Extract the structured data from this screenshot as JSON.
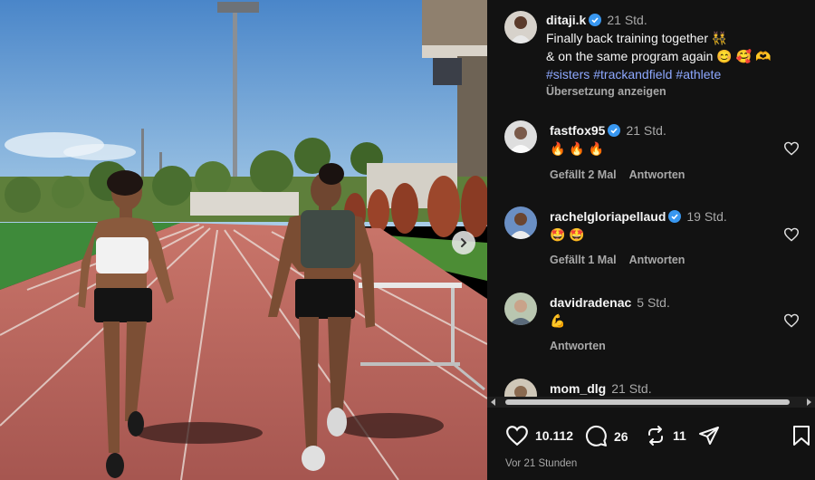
{
  "post": {
    "author": "ditaji.k",
    "time": "21 Std.",
    "caption_line1": "Finally back training together 👯",
    "caption_line2": "& on the same program again 😊 🥰 🫶",
    "hashtags": [
      "#sisters",
      "#trackandfield",
      "#athlete"
    ],
    "translate_label": "Übersetzung anzeigen"
  },
  "comments": [
    {
      "user": "fastfox95",
      "verified": true,
      "time": "21 Std.",
      "text": "🔥🔥🔥",
      "likes_label": "Gefällt 2 Mal",
      "reply_label": "Antworten"
    },
    {
      "user": "rachelgloriapellaud",
      "verified": true,
      "time": "19 Std.",
      "text": "🤩🤩",
      "likes_label": "Gefällt 1 Mal",
      "reply_label": "Antworten"
    },
    {
      "user": "davidradenac",
      "verified": false,
      "time": "5 Std.",
      "text": "💪",
      "likes_label": "",
      "reply_label": "Antworten"
    },
    {
      "user": "mom_dlg",
      "verified": false,
      "time": "21 Std.",
      "text": "",
      "likes_label": "",
      "reply_label": ""
    }
  ],
  "actions": {
    "likes": "10.112",
    "comments": "26",
    "reposts": "11"
  },
  "posted_label": "Vor 21 Stunden",
  "colors": {
    "background": "#121212",
    "hashtag": "#8da8ff",
    "verified": "#3897f0",
    "muted": "#a8a8a8"
  },
  "icons": [
    "verified-badge-icon",
    "heart-icon",
    "comment-icon",
    "repost-icon",
    "share-icon",
    "bookmark-icon",
    "chevron-right-icon"
  ]
}
